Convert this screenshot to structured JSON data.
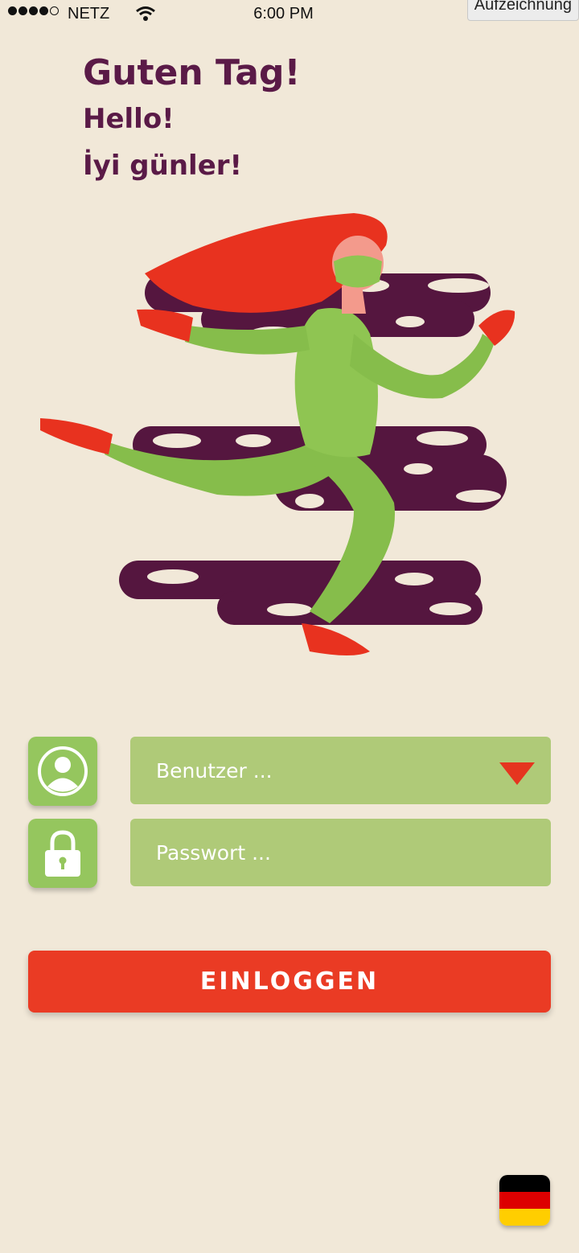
{
  "status_bar": {
    "carrier": "NETZ",
    "time": "6:00 PM",
    "recording_badge": "Aufzeichnung",
    "signal_bars": 4,
    "signal_max": 5
  },
  "greeting": {
    "line1": "Guten Tag!",
    "line2": "Hello!",
    "line3": "İyi günler!"
  },
  "form": {
    "user_placeholder": "Benutzer ...",
    "password_placeholder": "Passwort ...",
    "user_icon": "user-icon",
    "password_icon": "lock-icon",
    "dropdown_icon": "caret-down-icon"
  },
  "login_button": {
    "label": "EINLOGGEN"
  },
  "language": {
    "flag_icon": "german-flag-icon"
  },
  "colors": {
    "background": "#f1e8d8",
    "heading": "#5a1a47",
    "field": "#afca78",
    "icon_box": "#95c65e",
    "accent_red": "#ea3b24"
  }
}
